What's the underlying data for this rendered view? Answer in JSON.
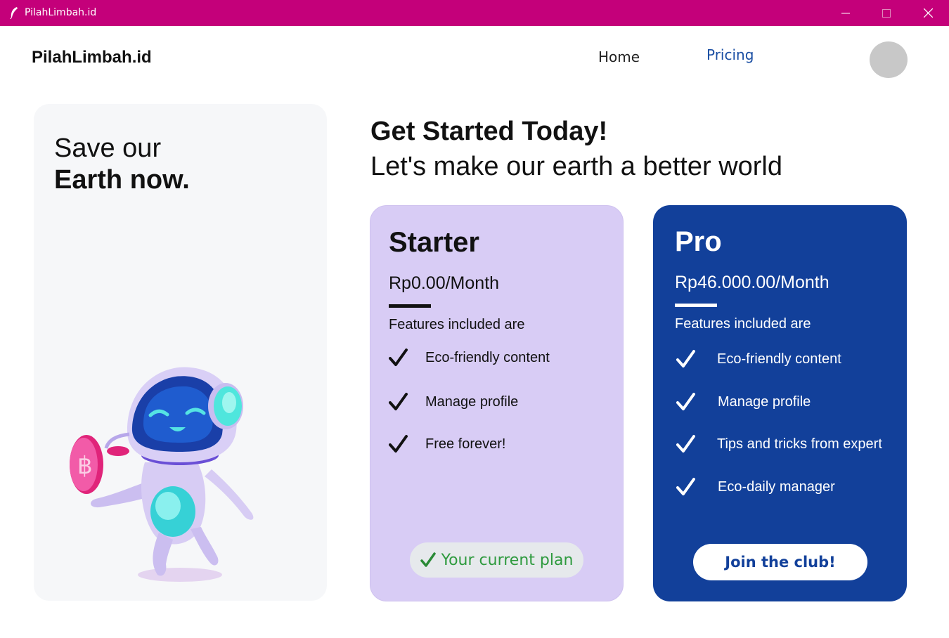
{
  "window": {
    "title": "PilahLimbah.id"
  },
  "nav": {
    "brand": "PilahLimbah.id",
    "home": "Home",
    "pricing": "Pricing"
  },
  "hero": {
    "line1": "Save our",
    "line2": "Earth now."
  },
  "heading": {
    "main": "Get Started Today!",
    "sub": "Let's make our earth a better world"
  },
  "plans": {
    "starter": {
      "name": "Starter",
      "price": "Rp0.00/Month",
      "features_title": "Features included are",
      "features": [
        "Eco-friendly content",
        "Manage profile",
        "Free forever!"
      ],
      "button": "Your current plan"
    },
    "pro": {
      "name": "Pro",
      "price": "Rp46.000.00/Month",
      "features_title": "Features included are",
      "features": [
        "Eco-friendly content",
        "Manage profile",
        "Tips and tricks from expert",
        "Eco-daily manager"
      ],
      "button": "Join the club!"
    }
  },
  "colors": {
    "titlebar": "#c4007a",
    "starter_card": "#d8ccf5",
    "pro_card": "#12409a",
    "pricing_link": "#1a4ea3",
    "current_plan_text": "#2e9a3e"
  },
  "icons": {
    "app": "feather-icon",
    "minimize": "minimize-icon",
    "maximize": "maximize-icon",
    "close": "close-icon",
    "check": "check-icon"
  }
}
